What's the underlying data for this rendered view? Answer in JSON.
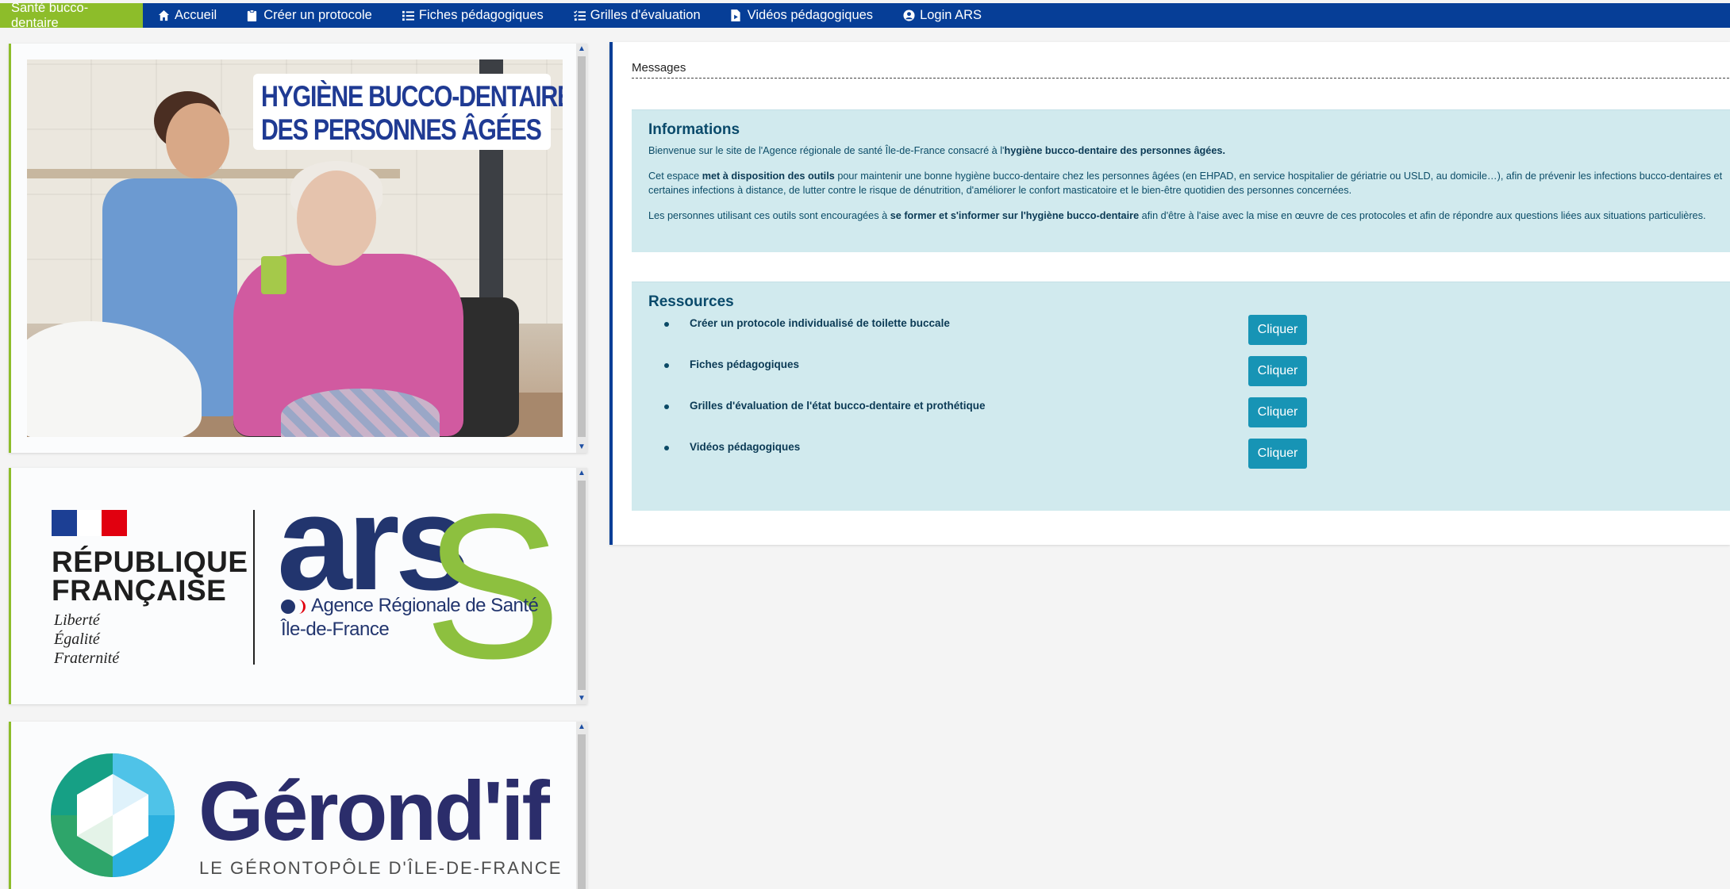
{
  "navbar": {
    "brand": "Santé bucco-dentaire",
    "items": [
      {
        "label": "Accueil",
        "icon": "home-icon"
      },
      {
        "label": "Créer un protocole",
        "icon": "clipboard-icon"
      },
      {
        "label": "Fiches pédagogiques",
        "icon": "list-icon"
      },
      {
        "label": "Grilles d'évaluation",
        "icon": "checklist-icon"
      },
      {
        "label": "Vidéos pédagogiques",
        "icon": "file-video-icon"
      },
      {
        "label": "Login ARS",
        "icon": "user-circle-icon"
      }
    ]
  },
  "left": {
    "poster": {
      "title_line1": "HYGIÈNE BUCCO-DENTAIRE",
      "title_line2": "DES PERSONNES ÂGÉES"
    },
    "rf_logo": {
      "name_line1": "RÉPUBLIQUE",
      "name_line2": "FRANÇAISE",
      "motto": [
        "Liberté",
        "Égalité",
        "Fraternité"
      ]
    },
    "ars_logo": {
      "big": "ars",
      "s": "S",
      "agency": "Agence Régionale de Santé",
      "region": "Île-de-France"
    },
    "gerondif_logo": {
      "name": "Gérond'if",
      "subtitle": "LE GÉRONTOPÔLE D'ÎLE-DE-FRANCE"
    }
  },
  "messages": {
    "label": "Messages",
    "info": {
      "title": "Informations",
      "p1_pre": "Bienvenue sur le site de l'Agence régionale de santé Île-de-France consacré à l'",
      "p1_bold": "hygiène bucco-dentaire des personnes âgées.",
      "p2_pre": "Cet espace ",
      "p2_bold": "met à disposition des outils",
      "p2_post": " pour maintenir une bonne hygiène bucco-dentaire chez les personnes âgées (en EHPAD, en service hospitalier de gériatrie ou USLD, au domicile…), afin de prévenir les infections bucco-dentaires et",
      "p2_line2": "certaines infections à distance, de lutter contre le risque de dénutrition, d'améliorer le confort masticatoire et le bien-être quotidien des personnes concernées.",
      "p3_pre": "Les personnes utilisant ces outils sont encouragées à ",
      "p3_bold": "se former et s'informer sur l'hygiène bucco-dentaire",
      "p3_post": " afin d'être à l'aise avec la mise en œuvre de ces protocoles et afin de répondre aux questions liées aux situations particulières."
    },
    "resources": {
      "title": "Ressources",
      "items": [
        {
          "label": "Créer un protocole individualisé de toilette buccale",
          "button": "Cliquer"
        },
        {
          "label": "Fiches pédagogiques",
          "button": "Cliquer"
        },
        {
          "label": "Grilles d'évaluation de l'état bucco-dentaire et prothétique",
          "button": "Cliquer"
        },
        {
          "label": "Vidéos pédagogiques",
          "button": "Cliquer"
        }
      ]
    }
  },
  "colors": {
    "navbar": "#063e97",
    "brand": "#8dbd2a",
    "box_bg": "#d1eaee",
    "button": "#1794b5"
  }
}
